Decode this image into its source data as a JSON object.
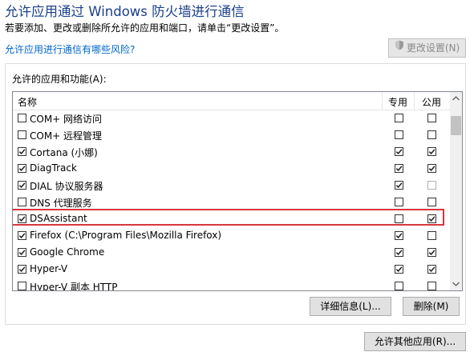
{
  "header": {
    "title": "允许应用通过 Windows 防火墙进行通信",
    "subtitle": "若要添加、更改或删除所允许的应用和端口，请单击“更改设置”。",
    "risk_link": "允许应用进行通信有哪些风险?",
    "change_settings_label": "更改设置(N)"
  },
  "group": {
    "label": "允许的应用和功能(A):"
  },
  "list": {
    "columns": {
      "name": "名称",
      "private": "专用",
      "public": "公用"
    },
    "rows": [
      {
        "name": "COM+ 网络访问",
        "enabled": false,
        "private": false,
        "public": false
      },
      {
        "name": "COM+ 远程管理",
        "enabled": false,
        "private": false,
        "public": false
      },
      {
        "name": "Cortana (小娜)",
        "enabled": true,
        "private": true,
        "public": true
      },
      {
        "name": "DiagTrack",
        "enabled": true,
        "private": true,
        "public": true
      },
      {
        "name": "DIAL 协议服务器",
        "enabled": true,
        "private": true,
        "public": false
      },
      {
        "name": "DNS 代理服务",
        "enabled": false,
        "private": false,
        "public": false
      },
      {
        "name": "DSAssistant",
        "enabled": true,
        "private": false,
        "public": true,
        "selected": true
      },
      {
        "name": "Firefox (C:\\Program Files\\Mozilla Firefox)",
        "enabled": true,
        "private": true,
        "public": false
      },
      {
        "name": "Google Chrome",
        "enabled": true,
        "private": true,
        "public": true
      },
      {
        "name": "Hyper-V",
        "enabled": true,
        "private": true,
        "public": true
      },
      {
        "name": "Hyper-V 副本 HTTP",
        "enabled": false,
        "private": false,
        "public": false
      }
    ]
  },
  "buttons": {
    "details": "详细信息(L)...",
    "delete": "删除(M)",
    "allow_other": "允许其他应用(R)..."
  },
  "colors": {
    "title": "#1a3f8a",
    "link": "#0066cc",
    "highlight_border": "#d9363e"
  }
}
